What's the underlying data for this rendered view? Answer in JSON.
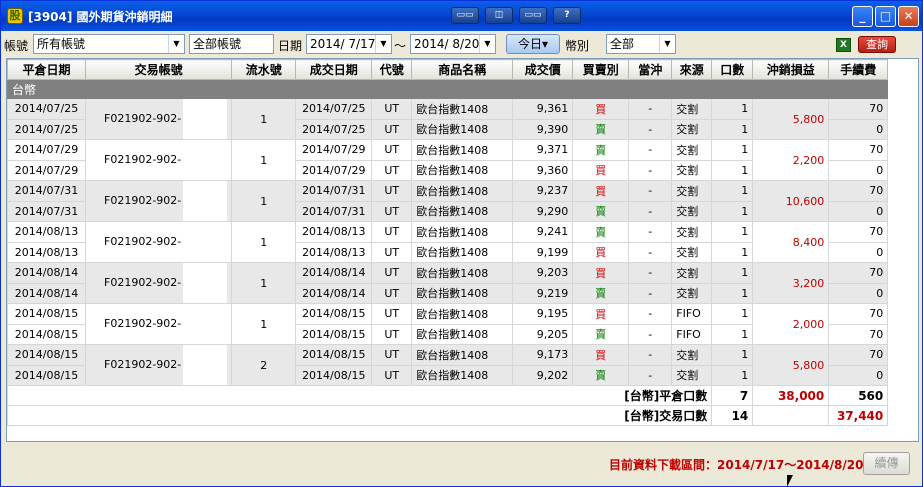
{
  "window": {
    "title": "[3904] 國外期貨沖銷明細",
    "app_icon": "股",
    "toolbar_buttons": [
      "▭▭",
      "◫",
      "▭▭",
      "?"
    ],
    "minimize": "_",
    "maximize": "□",
    "close": "✕"
  },
  "filters": {
    "account_label": "帳號",
    "account_value": "所有帳號",
    "account_all_label": "全部帳號",
    "date_label": "日期",
    "date_from": "2014/ 7/17",
    "date_sep": "～",
    "date_to": "2014/ 8/20",
    "today_button": "今日▾",
    "currency_label": "幣別",
    "currency_value": "全部",
    "excel_icon": "X",
    "query_button": "查詢"
  },
  "table": {
    "columns": [
      "平倉日期",
      "交易帳號",
      "流水號",
      "成交日期",
      "代號",
      "商品名稱",
      "成交價",
      "買賣別",
      "當沖",
      "來源",
      "口數",
      "沖銷損益",
      "手續費"
    ],
    "group_label": "台幣",
    "groups": [
      {
        "account": "F021902-902-",
        "serial": "1",
        "pnl": "5,800",
        "rows": [
          {
            "close_date": "2014/07/25",
            "trade_date": "2014/07/25",
            "code": "UT",
            "product": "歐台指數1408",
            "price": "9,361",
            "side": "買",
            "side_type": "buy",
            "daytrade": "-",
            "source": "交割",
            "qty": "1",
            "fee": "70"
          },
          {
            "close_date": "2014/07/25",
            "trade_date": "2014/07/25",
            "code": "UT",
            "product": "歐台指數1408",
            "price": "9,390",
            "side": "賣",
            "side_type": "sell",
            "daytrade": "-",
            "source": "交割",
            "qty": "1",
            "fee": "0"
          }
        ]
      },
      {
        "account": "F021902-902-",
        "serial": "1",
        "pnl": "2,200",
        "rows": [
          {
            "close_date": "2014/07/29",
            "trade_date": "2014/07/29",
            "code": "UT",
            "product": "歐台指數1408",
            "price": "9,371",
            "side": "賣",
            "side_type": "sell",
            "daytrade": "-",
            "source": "交割",
            "qty": "1",
            "fee": "70"
          },
          {
            "close_date": "2014/07/29",
            "trade_date": "2014/07/29",
            "code": "UT",
            "product": "歐台指數1408",
            "price": "9,360",
            "side": "買",
            "side_type": "buy",
            "daytrade": "-",
            "source": "交割",
            "qty": "1",
            "fee": "0"
          }
        ]
      },
      {
        "account": "F021902-902-",
        "serial": "1",
        "pnl": "10,600",
        "rows": [
          {
            "close_date": "2014/07/31",
            "trade_date": "2014/07/31",
            "code": "UT",
            "product": "歐台指數1408",
            "price": "9,237",
            "side": "買",
            "side_type": "buy",
            "daytrade": "-",
            "source": "交割",
            "qty": "1",
            "fee": "70"
          },
          {
            "close_date": "2014/07/31",
            "trade_date": "2014/07/31",
            "code": "UT",
            "product": "歐台指數1408",
            "price": "9,290",
            "side": "賣",
            "side_type": "sell",
            "daytrade": "-",
            "source": "交割",
            "qty": "1",
            "fee": "0"
          }
        ]
      },
      {
        "account": "F021902-902-",
        "serial": "1",
        "pnl": "8,400",
        "rows": [
          {
            "close_date": "2014/08/13",
            "trade_date": "2014/08/13",
            "code": "UT",
            "product": "歐台指數1408",
            "price": "9,241",
            "side": "賣",
            "side_type": "sell",
            "daytrade": "-",
            "source": "交割",
            "qty": "1",
            "fee": "70"
          },
          {
            "close_date": "2014/08/13",
            "trade_date": "2014/08/13",
            "code": "UT",
            "product": "歐台指數1408",
            "price": "9,199",
            "side": "買",
            "side_type": "buy",
            "daytrade": "-",
            "source": "交割",
            "qty": "1",
            "fee": "0"
          }
        ]
      },
      {
        "account": "F021902-902-",
        "serial": "1",
        "pnl": "3,200",
        "rows": [
          {
            "close_date": "2014/08/14",
            "trade_date": "2014/08/14",
            "code": "UT",
            "product": "歐台指數1408",
            "price": "9,203",
            "side": "買",
            "side_type": "buy",
            "daytrade": "-",
            "source": "交割",
            "qty": "1",
            "fee": "70"
          },
          {
            "close_date": "2014/08/14",
            "trade_date": "2014/08/14",
            "code": "UT",
            "product": "歐台指數1408",
            "price": "9,219",
            "side": "賣",
            "side_type": "sell",
            "daytrade": "-",
            "source": "交割",
            "qty": "1",
            "fee": "0"
          }
        ]
      },
      {
        "account": "F021902-902-",
        "serial": "1",
        "pnl": "2,000",
        "rows": [
          {
            "close_date": "2014/08/15",
            "trade_date": "2014/08/15",
            "code": "UT",
            "product": "歐台指數1408",
            "price": "9,195",
            "side": "買",
            "side_type": "buy",
            "daytrade": "-",
            "source": "FIFO",
            "qty": "1",
            "fee": "70"
          },
          {
            "close_date": "2014/08/15",
            "trade_date": "2014/08/15",
            "code": "UT",
            "product": "歐台指數1408",
            "price": "9,205",
            "side": "賣",
            "side_type": "sell",
            "daytrade": "-",
            "source": "FIFO",
            "qty": "1",
            "fee": "70"
          }
        ]
      },
      {
        "account": "F021902-902-",
        "serial": "2",
        "pnl": "5,800",
        "rows": [
          {
            "close_date": "2014/08/15",
            "trade_date": "2014/08/15",
            "code": "UT",
            "product": "歐台指數1408",
            "price": "9,173",
            "side": "買",
            "side_type": "buy",
            "daytrade": "-",
            "source": "交割",
            "qty": "1",
            "fee": "70"
          },
          {
            "close_date": "2014/08/15",
            "trade_date": "2014/08/15",
            "code": "UT",
            "product": "歐台指數1408",
            "price": "9,202",
            "side": "賣",
            "side_type": "sell",
            "daytrade": "-",
            "source": "交割",
            "qty": "1",
            "fee": "0"
          }
        ]
      }
    ],
    "summary": [
      {
        "label": "[台幣]平倉口數",
        "qty": "7",
        "pnl": "38,000",
        "fee": "560"
      },
      {
        "label": "[台幣]交易口數",
        "qty": "14",
        "pnl": "",
        "fee": "37,440"
      }
    ]
  },
  "footer": {
    "range_text": "目前資料下載區間：2014/7/17～2014/8/20",
    "continue_button": "續傳"
  },
  "colors": {
    "buy": "#d40000",
    "sell": "#007a00",
    "pnl": "#c00000",
    "group_row": "#808080",
    "row_shade": "#e8e8e8"
  }
}
